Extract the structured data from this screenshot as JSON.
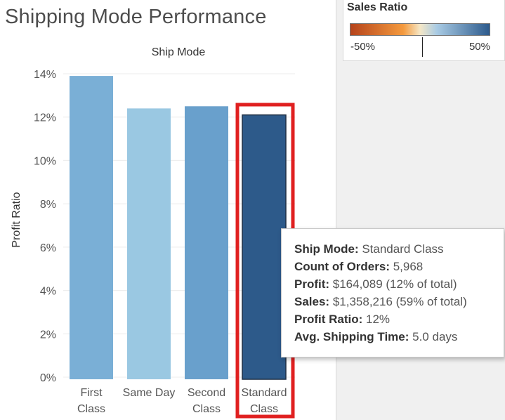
{
  "page": {
    "title": "Shipping Mode Performance"
  },
  "legend": {
    "title": "Sales Ratio",
    "min_label": "-50%",
    "max_label": "50%",
    "colors": [
      "#b5431b",
      "#f49a3e",
      "#f5e7c6",
      "#a9cbe4",
      "#2c5a8c"
    ]
  },
  "chart_data": {
    "type": "bar",
    "title": "",
    "header": "Ship Mode",
    "xlabel": "",
    "ylabel": "Profit Ratio",
    "categories": [
      "First Class",
      "Same Day",
      "Second Class",
      "Standard Class"
    ],
    "category_lines": [
      [
        "First",
        "Class"
      ],
      [
        "Same Day"
      ],
      [
        "Second",
        "Class"
      ],
      [
        "Standard",
        "Class"
      ]
    ],
    "values": [
      13.9,
      12.4,
      12.5,
      12.1
    ],
    "colors": [
      "#7aafd6",
      "#9ac8e2",
      "#69a0cc",
      "#2d5a8a"
    ],
    "ylim": [
      0,
      14.5
    ],
    "yticks": [
      0,
      2,
      4,
      6,
      8,
      10,
      12,
      14
    ],
    "ytick_labels": [
      "0%",
      "2%",
      "4%",
      "6%",
      "8%",
      "10%",
      "12%",
      "14%"
    ],
    "grid": true,
    "highlighted_category": "Standard Class",
    "highlight_color": "#e02020"
  },
  "tooltip": {
    "lines": [
      {
        "label": "Ship Mode:",
        "value": "Standard Class"
      },
      {
        "label": "Count of Orders:",
        "value": "5,968"
      },
      {
        "label": "Profit:",
        "value": "$164,089 (12% of total)"
      },
      {
        "label": "Sales:",
        "value": "$1,358,216 (59% of total)"
      },
      {
        "label": "Profit Ratio:",
        "value": "12%"
      },
      {
        "label": "Avg. Shipping Time:",
        "value": "5.0 days"
      }
    ]
  }
}
